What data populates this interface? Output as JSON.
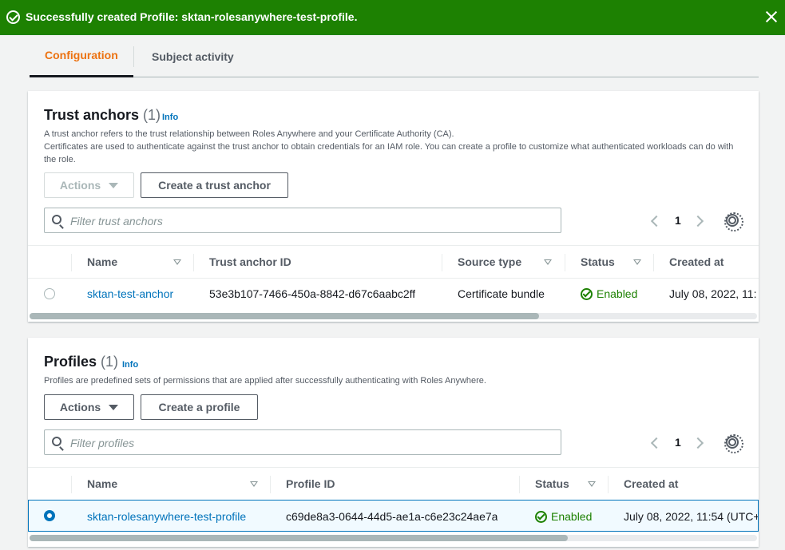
{
  "flash": {
    "message": "Successfully created Profile: sktan-rolesanywhere-test-profile.",
    "type": "success",
    "color": "#1d8102"
  },
  "tabs": [
    {
      "label": "Configuration",
      "active": true
    },
    {
      "label": "Subject activity",
      "active": false
    }
  ],
  "trust_anchors": {
    "title": "Trust anchors",
    "count": "(1)",
    "info": "Info",
    "description_line1": "A trust anchor refers to the trust relationship between Roles Anywhere and your Certificate Authority (CA).",
    "description_line2": "Certificates are used to authenticate against the trust anchor to obtain credentials for an IAM role. You can create a profile to customize what authenticated workloads can do with the role.",
    "actions_label": "Actions",
    "actions_disabled": true,
    "create_label": "Create a trust anchor",
    "search_placeholder": "Filter trust anchors",
    "page": "1",
    "columns": [
      "Name",
      "Trust anchor ID",
      "Source type",
      "Status",
      "Created at"
    ],
    "rows": [
      {
        "name": "sktan-test-anchor",
        "id": "53e3b107-7466-450a-8842-d67c6aabc2ff",
        "source_type": "Certificate bundle",
        "status": "Enabled",
        "created_at": "July 08, 2022, 11:",
        "selected": false
      }
    ],
    "scroll_fraction": 0.7
  },
  "profiles": {
    "title": "Profiles",
    "count": "(1)",
    "info": "Info",
    "description": "Profiles are predefined sets of permissions that are applied after successfully authenticating with Roles Anywhere.",
    "actions_label": "Actions",
    "actions_disabled": false,
    "create_label": "Create a profile",
    "search_placeholder": "Filter profiles",
    "page": "1",
    "columns": [
      "Name",
      "Profile ID",
      "Status",
      "Created at"
    ],
    "rows": [
      {
        "name": "sktan-rolesanywhere-test-profile",
        "id": "c69de8a3-0644-44d5-ae1a-c6e23c24ae7a",
        "status": "Enabled",
        "created_at": "July 08, 2022, 11:54 (UTC+",
        "selected": true
      }
    ],
    "scroll_fraction": 0.74
  },
  "colors": {
    "accent_orange": "#ec7211",
    "link_blue": "#0073bb",
    "success_green": "#1d8102"
  }
}
